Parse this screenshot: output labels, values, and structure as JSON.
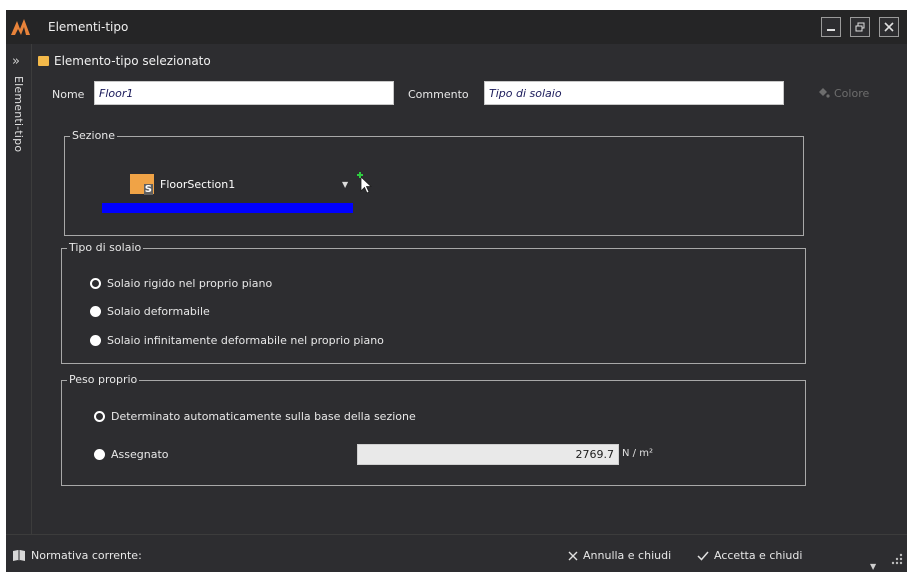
{
  "window": {
    "title": "Elementi-tipo",
    "side_panel_label": "Elementi-tipo"
  },
  "header": {
    "section_title": "Elemento-tipo selezionato"
  },
  "fields": {
    "name_label": "Nome",
    "name_value": "Floor1",
    "comment_label": "Commento",
    "comment_value": "Tipo di solaio",
    "color_button_label": "Colore"
  },
  "sezione": {
    "legend": "Sezione",
    "selected_section": "FloorSection1"
  },
  "tipo_solaio": {
    "legend": "Tipo di solaio",
    "options": [
      {
        "label": "Solaio rigido nel proprio piano",
        "checked": true
      },
      {
        "label": "Solaio deformabile",
        "checked": false
      },
      {
        "label": "Solaio infinitamente deformabile nel proprio piano",
        "checked": false
      }
    ]
  },
  "peso_proprio": {
    "legend": "Peso proprio",
    "options": [
      {
        "label": "Determinato automaticamente sulla base della sezione",
        "checked": true
      },
      {
        "label": "Assegnato",
        "checked": false
      }
    ],
    "assigned_value": "2769.7",
    "unit": "N / m²"
  },
  "footer": {
    "normativa_label": "Normativa corrente:",
    "cancel_label": "Annulla e chiudi",
    "accept_label": "Accetta e chiudi"
  },
  "colors": {
    "background": "#2d2d30",
    "titlebar": "#252526",
    "accent_orange": "#f0a346",
    "highlight_blue": "#0000ff",
    "disabled_text": "#6d6d6d"
  },
  "icons": [
    "app-logo-icon",
    "minimize-icon",
    "restore-icon",
    "close-icon",
    "double-chevron-icon",
    "folder-icon",
    "paint-bucket-icon",
    "section-icon",
    "dropdown-arrow-icon",
    "pick-cursor-icon",
    "book-icon",
    "x-icon",
    "check-icon",
    "resize-grip-icon"
  ]
}
